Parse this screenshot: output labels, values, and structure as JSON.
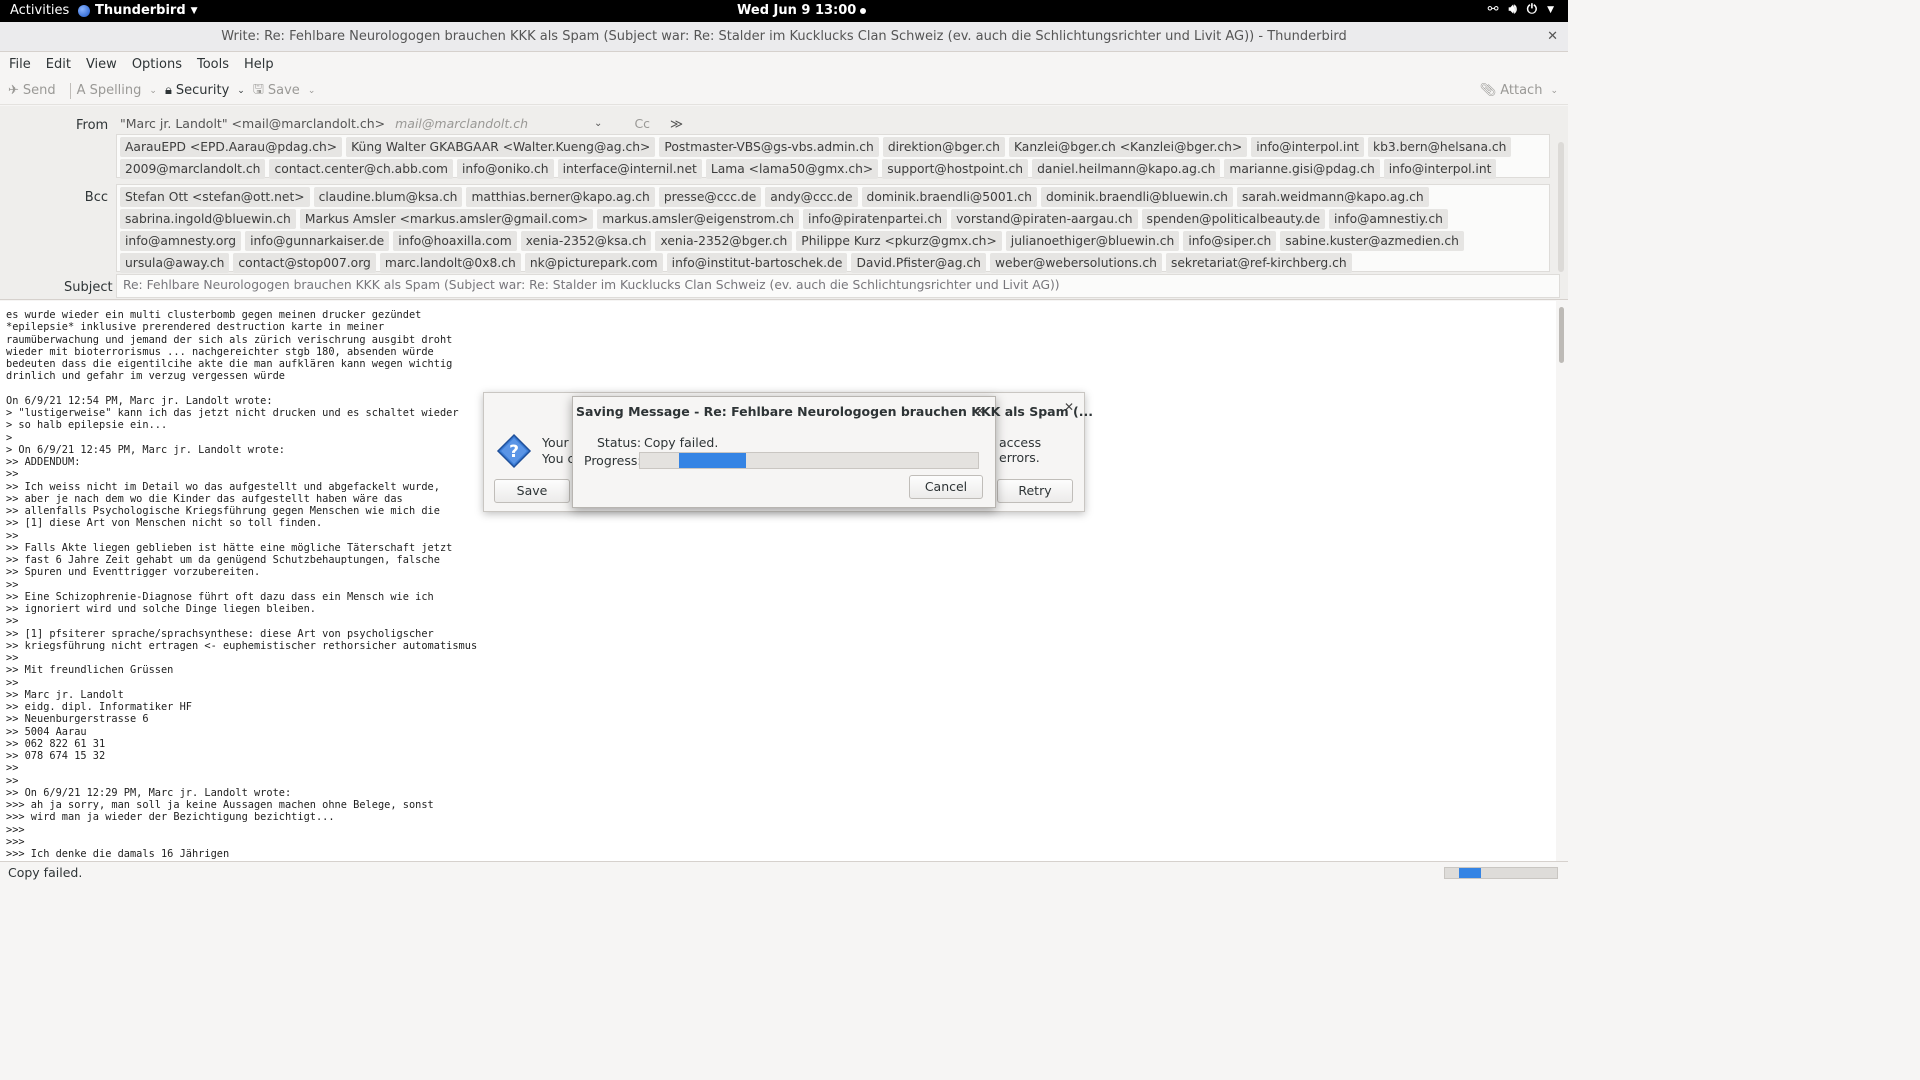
{
  "topbar": {
    "activities": "Activities",
    "app_name": "Thunderbird",
    "clock": "Wed Jun 9  13:00"
  },
  "window": {
    "title": "Write: Re: Fehlbare Neurologogen brauchen KKK als Spam (Subject war: Re: Stalder im Kucklucks Clan Schweiz (ev. auch die Schlichtungsrichter und Livit AG)) - Thunderbird"
  },
  "menu": {
    "file": "File",
    "edit": "Edit",
    "view": "View",
    "options": "Options",
    "tools": "Tools",
    "help": "Help"
  },
  "toolbar": {
    "send": "Send",
    "spelling": "Spelling",
    "security": "Security",
    "save": "Save",
    "attach": "Attach"
  },
  "headers": {
    "from_label": "From",
    "from_value": "\"Marc jr. Landolt\" <mail@marclandolt.ch>",
    "from_placeholder": "mail@marclandolt.ch",
    "cc": "Cc",
    "to_recipients": [
      "AarauEPD <EPD.Aarau@pdag.ch>",
      "Küng Walter GKABGAAR <Walter.Kueng@ag.ch>",
      "Postmaster-VBS@gs-vbs.admin.ch",
      "direktion@bger.ch",
      "Kanzlei@bger.ch <Kanzlei@bger.ch>",
      "info@interpol.int",
      "kb3.bern@helsana.ch",
      "2009@marclandolt.ch",
      "contact.center@ch.abb.com",
      "info@oniko.ch",
      "interface@internil.net",
      "Lama <lama50@gmx.ch>",
      "support@hostpoint.ch",
      "daniel.heilmann@kapo.ag.ch",
      "marianne.gisi@pdag.ch",
      "info@interpol.int"
    ],
    "bcc_label": "Bcc",
    "bcc_recipients": [
      "Stefan Ott <stefan@ott.net>",
      "claudine.blum@ksa.ch",
      "matthias.berner@kapo.ag.ch",
      "presse@ccc.de",
      "andy@ccc.de",
      "dominik.braendli@5001.ch",
      "dominik.braendli@bluewin.ch",
      "sarah.weidmann@kapo.ag.ch",
      "sabrina.ingold@bluewin.ch",
      "Markus Amsler <markus.amsler@gmail.com>",
      "markus.amsler@eigenstrom.ch",
      "info@piratenpartei.ch",
      "vorstand@piraten-aargau.ch",
      "spenden@politicalbeauty.de",
      "info@amnestiy.ch",
      "info@amnesty.org",
      "info@gunnarkaiser.de",
      "info@hoaxilla.com",
      "xenia-2352@ksa.ch",
      "xenia-2352@bger.ch",
      "Philippe Kurz <pkurz@gmx.ch>",
      "julianoethiger@bluewin.ch",
      "info@siper.ch",
      "sabine.kuster@azmedien.ch",
      "ursula@away.ch",
      "contact@stop007.org",
      "marc.landolt@0x8.ch",
      "nk@picturepark.com",
      "info@institut-bartoschek.de",
      "David.Pfister@ag.ch",
      "weber@webersolutions.ch",
      "sekretariat@ref-kirchberg.ch"
    ],
    "subject_label": "Subject",
    "subject_value": "Re: Fehlbare Neurologogen brauchen KKK als Spam (Subject war: Re: Stalder im Kucklucks Clan Schweiz (ev. auch die Schlichtungsrichter und Livit AG))"
  },
  "body_text": "es wurde wieder ein multi clusterbomb gegen meinen drucker gezündet\n*epilepsie* inklusive prerendered destruction karte in meiner\nraumüberwachung und jemand der sich als zürich verischrung ausgibt droht\nwieder mit bioterrorismus ... nachgereichter stgb 180, absenden würde\nbedeuten dass die eigentilcihe akte die man aufklären kann wegen wichtig\ndrinlich und gefahr im verzug vergessen würde\n\nOn 6/9/21 12:54 PM, Marc jr. Landolt wrote:\n> \"lustigerweise\" kann ich das jetzt nicht drucken und es schaltet wieder\n> so halb epilepsie ein...\n>\n> On 6/9/21 12:45 PM, Marc jr. Landolt wrote:\n>> ADDENDUM:\n>>\n>> Ich weiss nicht im Detail wo das aufgestellt und abgefackelt wurde,\n>> aber je nach dem wo die Kinder das aufgestellt haben wäre das\n>> allenfalls Psychologische Kriegsführung gegen Menschen wie mich die\n>> [1] diese Art von Menschen nicht so toll finden.\n>>\n>> Falls Akte liegen geblieben ist hätte eine mögliche Täterschaft jetzt\n>> fast 6 Jahre Zeit gehabt um da genügend Schutzbehauptungen, falsche\n>> Spuren und Eventtrigger vorzubereiten.\n>>\n>> Eine Schizophrenie-Diagnose führt oft dazu dass ein Mensch wie ich\n>> ignoriert wird und solche Dinge liegen bleiben.\n>>\n>> [1] pfsiterer sprache/sprachsynthese: diese Art von psycholigscher\n>> kriegsführung nicht ertragen <- euphemistischer rethorsicher automatismus\n>>\n>> Mit freundlichen Grüssen\n>>\n>> Marc jr. Landolt\n>> eidg. dipl. Informatiker HF\n>> Neuenburgerstrasse 6\n>> 5004 Aarau\n>> 062 822 61 31\n>> 078 674 15 32\n>>\n>>\n>> On 6/9/21 12:29 PM, Marc jr. Landolt wrote:\n>>> ah ja sorry, man soll ja keine Aussagen machen ohne Belege, sonst\n>>> wird man ja wieder der Bezichtigung bezichtigt...\n>>>\n>>>\n>>> Ich denke die damals 16 Jährigen",
  "dialog_back": {
    "message_line1": "Your e",
    "message_line2": "You c",
    "message_tail": "access errors.",
    "save": "Save",
    "retry": "Retry"
  },
  "dialog_front": {
    "title": "Saving Message - Re: Fehlbare Neurologogen brauchen KKK als Spam (...",
    "status_label": "Status:",
    "status_value": "Copy failed.",
    "progress_label": "Progress:",
    "cancel": "Cancel"
  },
  "statusbar": {
    "text": "Copy failed."
  },
  "colors": {
    "accent": "#3584e4",
    "topbar": "#000000"
  }
}
